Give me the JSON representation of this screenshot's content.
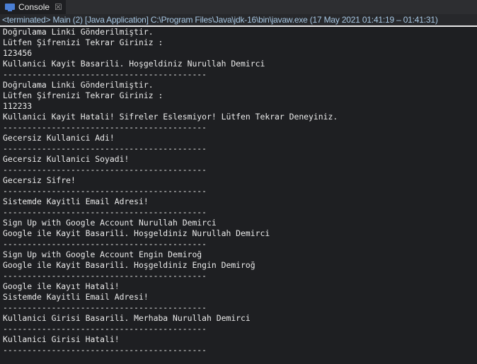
{
  "tab": {
    "label": "Console",
    "icon": "console-icon",
    "close_icon": "close-icon"
  },
  "status": "<terminated> Main (2) [Java Application] C:\\Program Files\\Java\\jdk-16\\bin\\javaw.exe  (17 May 2021 01:41:19 – 01:41:31)",
  "colors": {
    "background": "#1e1f22",
    "text": "#ebebeb",
    "status_text": "#a8c8e4"
  },
  "lines": [
    "Doğrulama Linki Gönderilmiştir.",
    "Lütfen Şifrenizi Tekrar Giriniz :",
    "123456",
    "Kullanici Kayit Basarili. Hoşgeldiniz Nurullah Demirci",
    "------------------------------------------",
    "Doğrulama Linki Gönderilmiştir.",
    "Lütfen Şifrenizi Tekrar Giriniz :",
    "112233",
    "Kullanici Kayit Hatali! Sifreler Eslesmiyor! Lütfen Tekrar Deneyiniz.",
    "------------------------------------------",
    "Gecersiz Kullanici Adi!",
    "------------------------------------------",
    "Gecersiz Kullanici Soyadi!",
    "------------------------------------------",
    "Gecersiz Sifre!",
    "------------------------------------------",
    "Sistemde Kayitli Email Adresi!",
    "------------------------------------------",
    "Sign Up with Google Account Nurullah Demirci",
    "Google ile Kayit Basarili. Hoşgeldiniz Nurullah Demirci",
    "------------------------------------------",
    "Sign Up with Google Account Engin Demiroğ",
    "Google ile Kayit Basarili. Hoşgeldiniz Engin Demiroğ",
    "------------------------------------------",
    "Google ile Kayıt Hatali!",
    "Sistemde Kayitli Email Adresi!",
    "------------------------------------------",
    "Kullanici Girisi Basarili. Merhaba Nurullah Demirci",
    "------------------------------------------",
    "Kullanici Girisi Hatali!",
    "------------------------------------------"
  ]
}
